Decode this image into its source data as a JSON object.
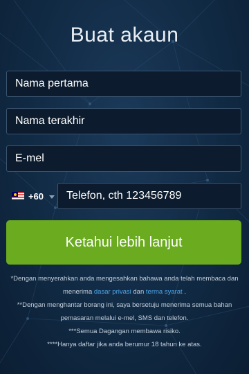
{
  "page": {
    "title": "Buat akaun"
  },
  "form": {
    "first_name_placeholder": "Nama pertama",
    "last_name_placeholder": "Nama terakhir",
    "email_placeholder": "E-mel",
    "phone": {
      "country_flag": "malaysia-flag-icon",
      "dial_code": "+60",
      "placeholder": "Telefon, cth 123456789"
    },
    "submit_label": "Ketahui lebih lanjut"
  },
  "disclaimers": {
    "line1_part1": "*Dengan menyerahkan anda mengesahkan bahawa anda telah membaca dan menerima ",
    "privacy_link": "dasar privasi",
    "line1_part2": " dan ",
    "terms_link": "terma syarat",
    "line1_part3": " .",
    "line2": "**Dengan menghantar borang ini, saya bersetuju menerima semua bahan pemasaran melalui e-mel, SMS dan telefon.",
    "line3": "***Semua Dagangan membawa risiko.",
    "line4": "****Hanya daftar jika anda berumur 18 tahun ke atas."
  },
  "colors": {
    "background": "#112a44",
    "input_bg": "#0c1c2e",
    "input_border": "#3c5570",
    "button": "#6aab1f",
    "link": "#4fa6e8"
  }
}
